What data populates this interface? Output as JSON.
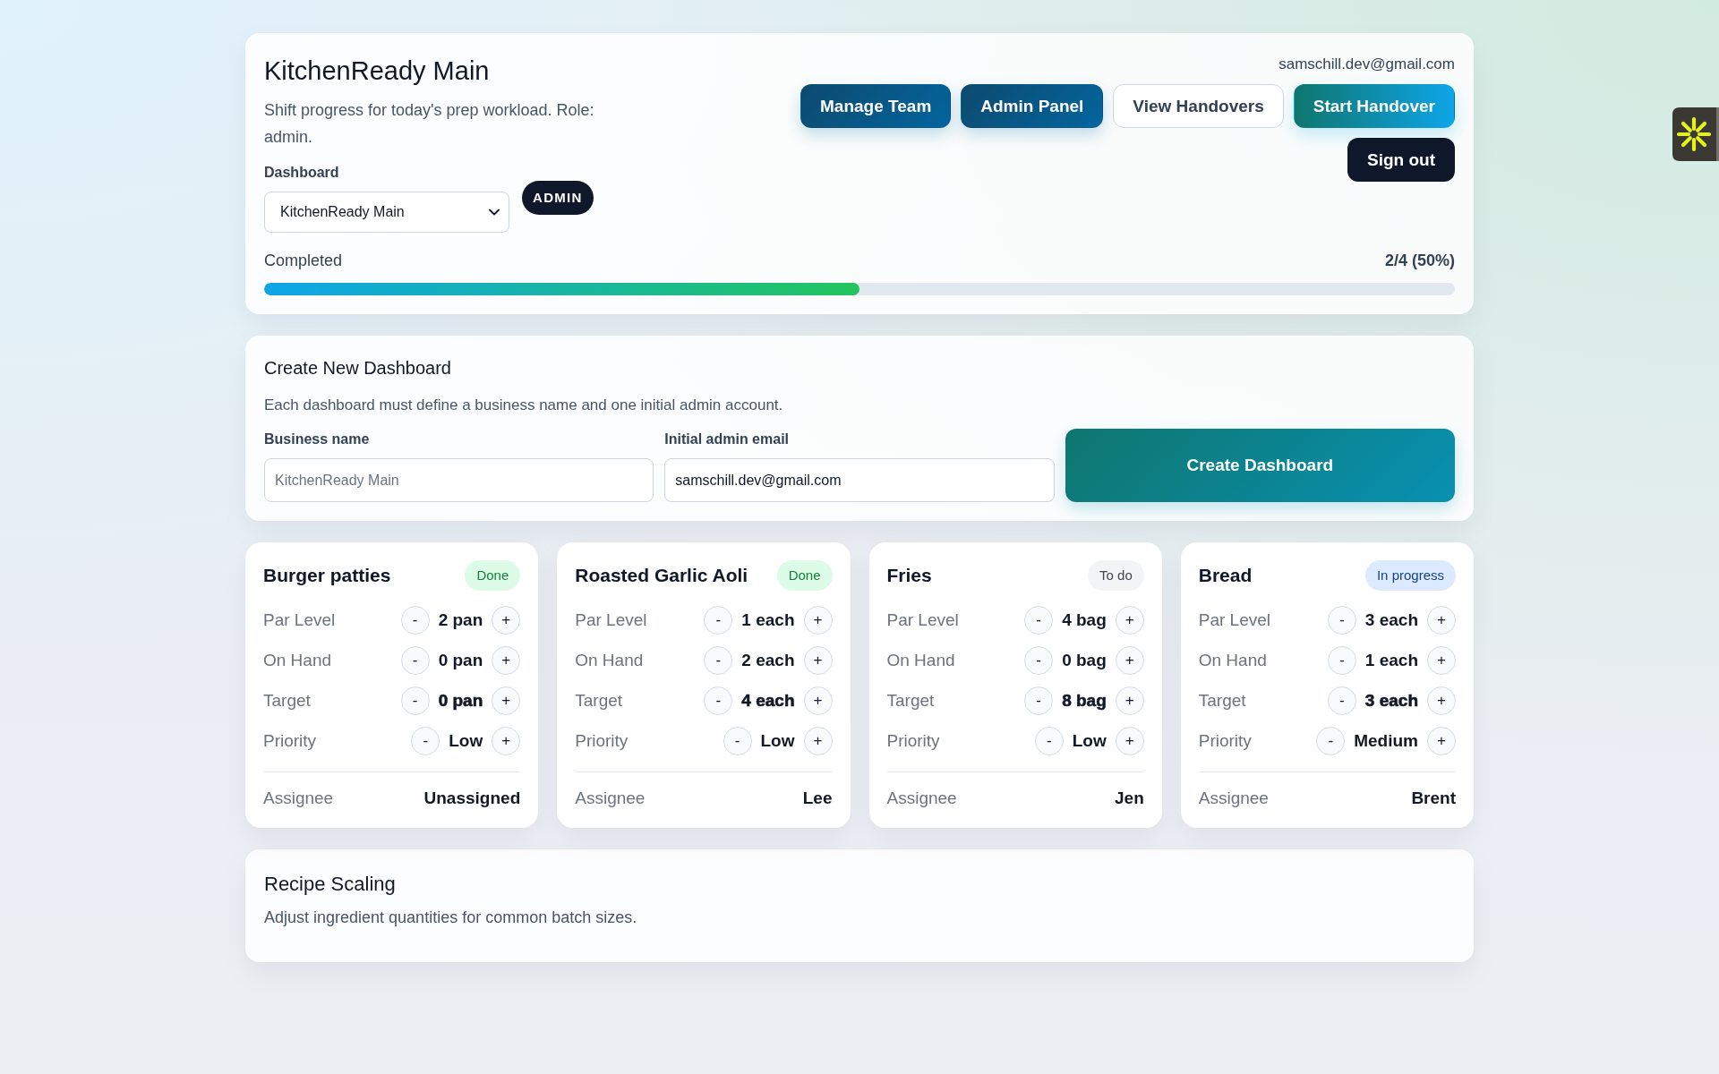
{
  "header": {
    "title": "KitchenReady Main",
    "subtitle": "Shift progress for today's prep workload. Role: admin.",
    "dashboard_select": {
      "label": "Dashboard",
      "value": "KitchenReady Main"
    },
    "role_badge": "ADMIN",
    "user_email": "samschill.dev@gmail.com",
    "action_rows": [
      [
        {
          "label": "Manage Team",
          "kind": "primary"
        },
        {
          "label": "Admin Panel",
          "kind": "primary"
        },
        {
          "label": "View Handovers",
          "kind": "outline"
        },
        {
          "label": "Start Handover",
          "kind": "accent"
        }
      ],
      [
        {
          "label": "Sign out",
          "kind": "dark"
        }
      ]
    ],
    "progress": {
      "label": "Completed",
      "reading": "2/4 (50%)",
      "level": 0.5
    }
  },
  "create_dashboard": {
    "title": "Create New Dashboard",
    "description": "Each dashboard must define a business name and one initial admin account.",
    "fields": [
      {
        "label": "Business name",
        "placeholder": "KitchenReady Main"
      },
      {
        "label": "Initial admin email",
        "value": "samschill.dev@gmail.com"
      }
    ],
    "button": "Create Dashboard"
  },
  "prep_items": [
    {
      "name": "Burger patties",
      "status": "Done",
      "color": "#dcfce7",
      "fields": [
        {
          "label": "Par Level",
          "value": "2 pan",
          "bold": false,
          "decrement": "-",
          "increment": "+"
        },
        {
          "label": "On Hand",
          "value": "0 pan",
          "bold": false,
          "decrement": "-",
          "increment": "+"
        },
        {
          "label": "Target",
          "value": "0 pan",
          "bold": true,
          "decrement": "-",
          "increment": "+"
        },
        {
          "label": "Priority",
          "value": "Low",
          "bold": false,
          "decrement": "-",
          "increment": "+"
        }
      ],
      "assignee_label": "Assignee",
      "assignee": "Unassigned"
    },
    {
      "name": "Roasted Garlic Aoli",
      "status": "Done",
      "color": "#dcfce7",
      "fields": [
        {
          "label": "Par Level",
          "value": "1 each",
          "bold": false,
          "decrement": "-",
          "increment": "+"
        },
        {
          "label": "On Hand",
          "value": "2 each",
          "bold": false,
          "decrement": "-",
          "increment": "+"
        },
        {
          "label": "Target",
          "value": "4 each",
          "bold": true,
          "decrement": "-",
          "increment": "+"
        },
        {
          "label": "Priority",
          "value": "Low",
          "bold": false,
          "decrement": "-",
          "increment": "+"
        }
      ],
      "assignee_label": "Assignee",
      "assignee": "Lee"
    },
    {
      "name": "Fries",
      "status": "To do",
      "color": "#f3f4f6",
      "fields": [
        {
          "label": "Par Level",
          "value": "4 bag",
          "bold": false,
          "decrement": "-",
          "increment": "+"
        },
        {
          "label": "On Hand",
          "value": "0 bag",
          "bold": false,
          "decrement": "-",
          "increment": "+"
        },
        {
          "label": "Target",
          "value": "8 bag",
          "bold": true,
          "decrement": "-",
          "increment": "+"
        },
        {
          "label": "Priority",
          "value": "Low",
          "bold": false,
          "decrement": "-",
          "increment": "+"
        }
      ],
      "assignee_label": "Assignee",
      "assignee": "Jen"
    },
    {
      "name": "Bread",
      "status": "In progress",
      "color": "#dbeafe",
      "fields": [
        {
          "label": "Par Level",
          "value": "3 each",
          "bold": false,
          "decrement": "-",
          "increment": "+"
        },
        {
          "label": "On Hand",
          "value": "1 each",
          "bold": false,
          "decrement": "-",
          "increment": "+"
        },
        {
          "label": "Target",
          "value": "3 each",
          "bold": true,
          "decrement": "-",
          "increment": "+"
        },
        {
          "label": "Priority",
          "value": "Medium",
          "bold": false,
          "decrement": "-",
          "increment": "+"
        }
      ],
      "assignee_label": "Assignee",
      "assignee": "Brent"
    }
  ],
  "recipe_scaling": {
    "title": "Recipe Scaling",
    "description": "Adjust ingredient quantities for common batch sizes."
  }
}
